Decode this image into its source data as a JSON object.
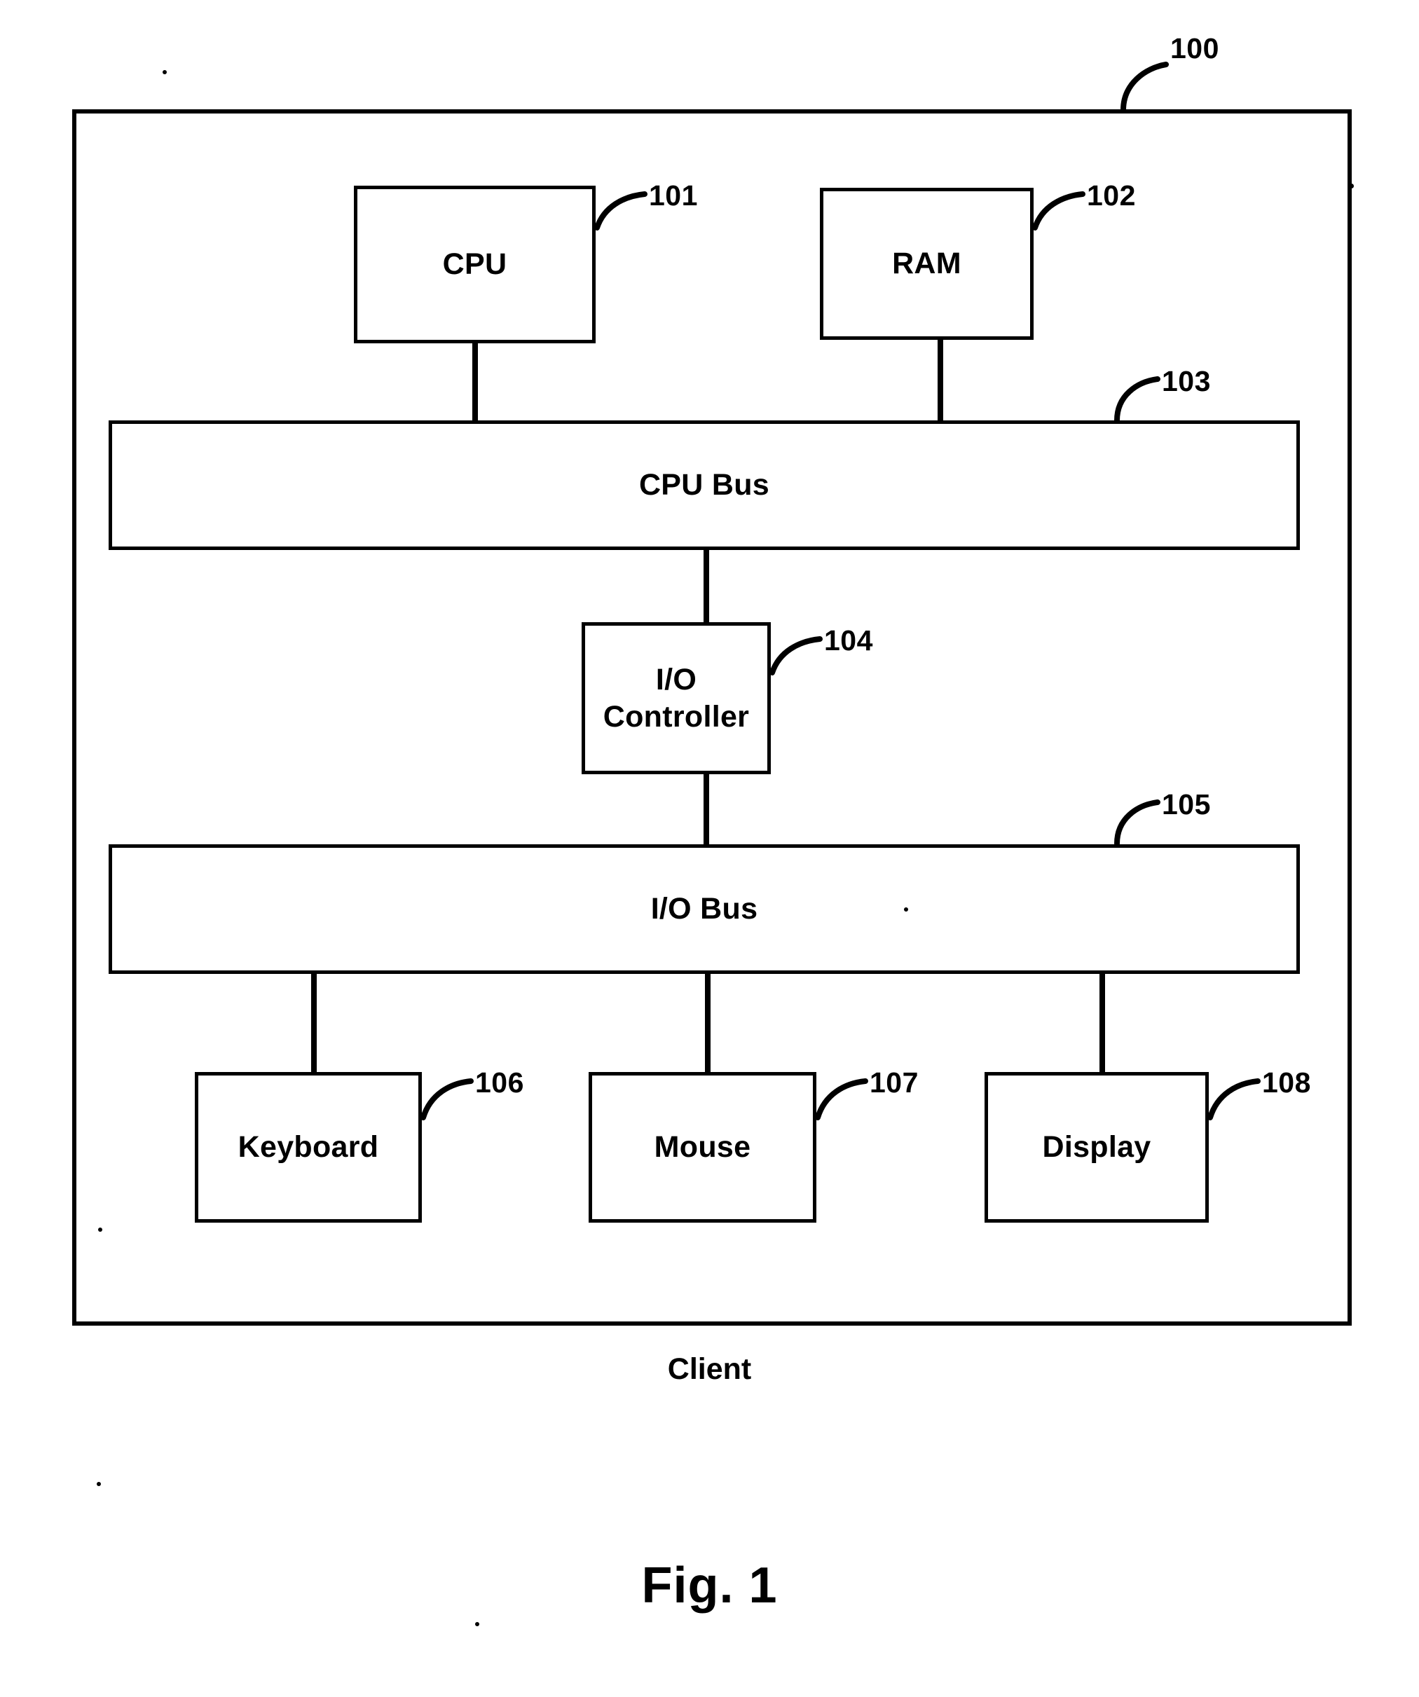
{
  "figure": {
    "title": "Fig. 1",
    "caption": "Client"
  },
  "nodes": [
    {
      "id": "system",
      "label": "",
      "ref": "100"
    },
    {
      "id": "cpu",
      "label": "CPU",
      "ref": "101"
    },
    {
      "id": "ram",
      "label": "RAM",
      "ref": "102"
    },
    {
      "id": "cpu-bus",
      "label": "CPU Bus",
      "ref": "103"
    },
    {
      "id": "io-controller",
      "label": "I/O\nController",
      "ref": "104"
    },
    {
      "id": "io-bus",
      "label": "I/O Bus",
      "ref": "105"
    },
    {
      "id": "keyboard",
      "label": "Keyboard",
      "ref": "106"
    },
    {
      "id": "mouse",
      "label": "Mouse",
      "ref": "107"
    },
    {
      "id": "display",
      "label": "Display",
      "ref": "108"
    }
  ],
  "connections": [
    {
      "from": "cpu",
      "to": "cpu-bus"
    },
    {
      "from": "ram",
      "to": "cpu-bus"
    },
    {
      "from": "cpu-bus",
      "to": "io-controller"
    },
    {
      "from": "io-controller",
      "to": "io-bus"
    },
    {
      "from": "io-bus",
      "to": "keyboard"
    },
    {
      "from": "io-bus",
      "to": "mouse"
    },
    {
      "from": "io-bus",
      "to": "display"
    }
  ],
  "colors": {
    "stroke": "#000000",
    "background": "#ffffff",
    "text": "#000000"
  }
}
